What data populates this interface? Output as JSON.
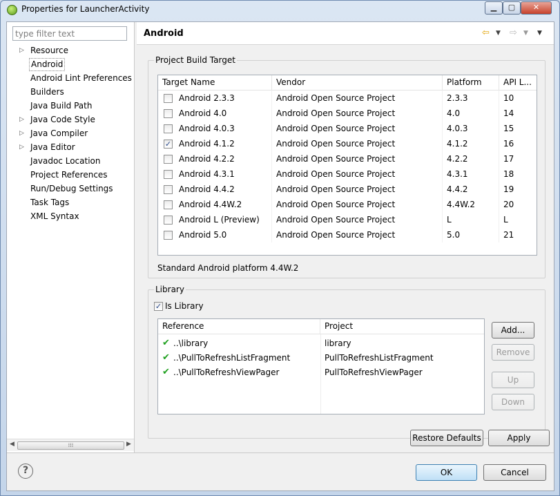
{
  "window": {
    "title": "Properties for LauncherActivity",
    "minimize_label": "▁",
    "maximize_label": "▢",
    "close_label": "✕"
  },
  "filter": {
    "placeholder": "type filter text"
  },
  "tree": [
    {
      "label": "Resource",
      "expandable": true
    },
    {
      "label": "Android",
      "expandable": false,
      "selected": true
    },
    {
      "label": "Android Lint Preferences",
      "expandable": false
    },
    {
      "label": "Builders",
      "expandable": false
    },
    {
      "label": "Java Build Path",
      "expandable": false
    },
    {
      "label": "Java Code Style",
      "expandable": true
    },
    {
      "label": "Java Compiler",
      "expandable": true
    },
    {
      "label": "Java Editor",
      "expandable": true
    },
    {
      "label": "Javadoc Location",
      "expandable": false
    },
    {
      "label": "Project References",
      "expandable": false
    },
    {
      "label": "Run/Debug Settings",
      "expandable": false
    },
    {
      "label": "Task Tags",
      "expandable": false
    },
    {
      "label": "XML Syntax",
      "expandable": false
    }
  ],
  "page": {
    "title": "Android"
  },
  "build_target": {
    "group_label": "Project Build Target",
    "columns": [
      "Target Name",
      "Vendor",
      "Platform",
      "API L..."
    ],
    "rows": [
      {
        "name": "Android 2.3.3",
        "vendor": "Android Open Source Project",
        "platform": "2.3.3",
        "api": "10",
        "checked": false
      },
      {
        "name": "Android 4.0",
        "vendor": "Android Open Source Project",
        "platform": "4.0",
        "api": "14",
        "checked": false
      },
      {
        "name": "Android 4.0.3",
        "vendor": "Android Open Source Project",
        "platform": "4.0.3",
        "api": "15",
        "checked": false
      },
      {
        "name": "Android 4.1.2",
        "vendor": "Android Open Source Project",
        "platform": "4.1.2",
        "api": "16",
        "checked": true
      },
      {
        "name": "Android 4.2.2",
        "vendor": "Android Open Source Project",
        "platform": "4.2.2",
        "api": "17",
        "checked": false
      },
      {
        "name": "Android 4.3.1",
        "vendor": "Android Open Source Project",
        "platform": "4.3.1",
        "api": "18",
        "checked": false
      },
      {
        "name": "Android 4.4.2",
        "vendor": "Android Open Source Project",
        "platform": "4.4.2",
        "api": "19",
        "checked": false
      },
      {
        "name": "Android 4.4W.2",
        "vendor": "Android Open Source Project",
        "platform": "4.4W.2",
        "api": "20",
        "checked": false
      },
      {
        "name": "Android L (Preview)",
        "vendor": "Android Open Source Project",
        "platform": "L",
        "api": "L",
        "checked": false
      },
      {
        "name": "Android 5.0",
        "vendor": "Android Open Source Project",
        "platform": "5.0",
        "api": "21",
        "checked": false
      }
    ],
    "status": "Standard Android platform 4.4W.2"
  },
  "library": {
    "group_label": "Library",
    "is_library_label": "Is Library",
    "is_library_checked": true,
    "columns": [
      "Reference",
      "Project"
    ],
    "rows": [
      {
        "reference": "..\\library",
        "project": "library"
      },
      {
        "reference": "..\\PullToRefreshListFragment",
        "project": "PullToRefreshListFragment"
      },
      {
        "reference": "..\\PullToRefreshViewPager",
        "project": "PullToRefreshViewPager"
      }
    ],
    "buttons": {
      "add": "Add...",
      "remove": "Remove",
      "up": "Up",
      "down": "Down"
    }
  },
  "footer": {
    "restore_defaults": "Restore Defaults",
    "apply": "Apply",
    "ok": "OK",
    "cancel": "Cancel",
    "help_glyph": "?"
  }
}
